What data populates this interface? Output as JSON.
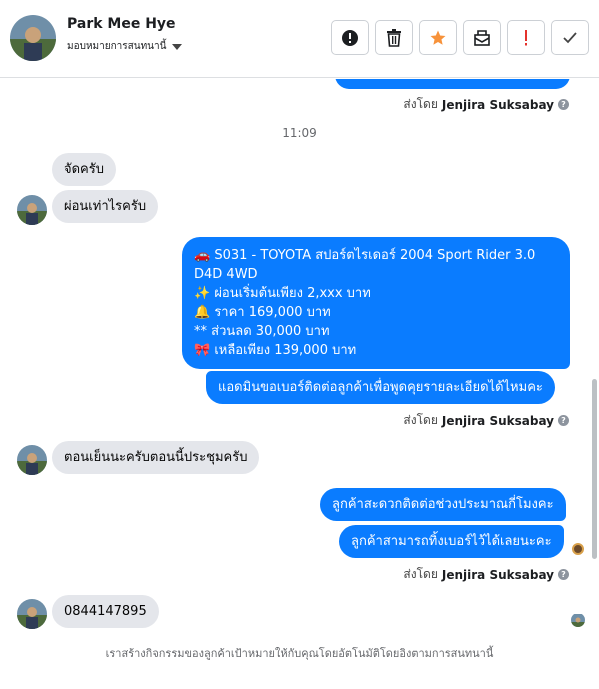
{
  "header": {
    "contact_name": "Park Mee Hye",
    "assign_label": "มอบหมายการสนทนานี้",
    "actions": [
      {
        "name": "alert-button",
        "icon": "alert-circle-icon"
      },
      {
        "name": "delete-button",
        "icon": "trash-icon"
      },
      {
        "name": "star-button",
        "icon": "star-icon"
      },
      {
        "name": "archive-button",
        "icon": "archive-icon"
      },
      {
        "name": "spam-button",
        "icon": "exclamation-icon"
      },
      {
        "name": "done-button",
        "icon": "check-icon"
      }
    ],
    "colors": {
      "star": "#f7923a",
      "spam": "#e4322c"
    }
  },
  "thread": {
    "sent_by_prefix": "ส่งโดย",
    "sent_by_name": "Jenjira Suksabay",
    "timestamp": "11:09",
    "messages": {
      "in_1": "จัดครับ",
      "in_2": "ผ่อนเท่าไรครับ",
      "out_1_line1": "🚗 S031 - TOYOTA สปอร์ตไรเดอร์ 2004 Sport Rider 3.0",
      "out_1_line2": "D4D 4WD",
      "out_1_line3": "✨ ผ่อนเริ่มต้นเพียง 2,xxx บาท",
      "out_1_line4": "🔔  ราคา 169,000 บาท",
      "out_1_line5": "** ส่วนลด 30,000 บาท",
      "out_1_line6": "🎀 เหลือเพียง 139,000 บาท",
      "out_2": "แอดมินขอเบอร์ติดต่อลูกค้าเพื่อพูดคุยรายละเอียดได้ไหมคะ",
      "in_3": "ตอนเย็นนะครับตอนนี้ประชุมครับ",
      "out_3": "ลูกค้าสะดวกติดต่อช่วงประมาณกี่โมงคะ",
      "out_4": "ลูกค้าสามารถทิ้งเบอร์ไว้ได้เลยนะคะ",
      "in_4": "0844147895"
    },
    "footer_note": "เราสร้างกิจกรรมของลูกค้าเป้าหมายให้กับคุณโดยอัตโนมัติโดยอิงตามการสนทนานี้"
  },
  "colors": {
    "outgoing_bubble": "#0a7cff",
    "incoming_bubble": "#e4e6eb"
  }
}
